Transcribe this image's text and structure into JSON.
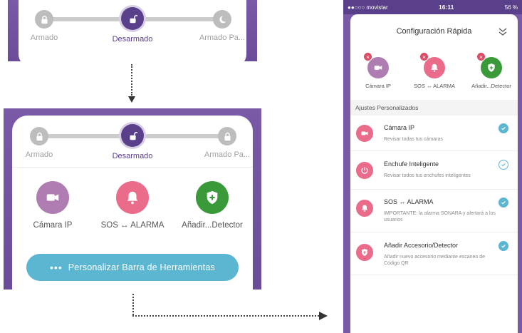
{
  "modes": {
    "armed": "Armado",
    "disarmed": "Desarmado",
    "home": "Armado Pa..."
  },
  "quick_actions": {
    "camera": "Cámara IP",
    "sos": "SOS ↔ ALARMA",
    "add": "Añadir...Detector"
  },
  "customize_button": {
    "dots": "•••",
    "label": "Personalizar Barra de Herramientas"
  },
  "phone": {
    "status_bar": {
      "carrier": "●●○○○ movistar",
      "time": "16:11",
      "battery": "56 %"
    },
    "title": "Configuración Rápida",
    "shortcuts": {
      "camera": "Cámara IP",
      "sos": "SOS ↔ ALARMA",
      "add": "Añadir...Detector"
    },
    "section_header": "Ajustes Personalizados",
    "items": [
      {
        "title": "Cámara IP",
        "subtitle": "Revisar todas tus cámaras",
        "checked": true
      },
      {
        "title": "Enchufe Inteligente",
        "subtitle": "Revisar todos tus enchufes inteligentes",
        "checked": false
      },
      {
        "title": "SOS ↔ ALARMA",
        "subtitle": "IMPORTANTE: la alarma SONARA y alertará a los usuarios",
        "checked": true
      },
      {
        "title": "Añadir Accesorio/Detector",
        "subtitle": "Añadir nuevo accesorio mediante escaneo de Código QR",
        "checked": true
      }
    ]
  },
  "colors": {
    "brand_purple": "#5a3f8a",
    "camera_purple": "#b07db2",
    "sos_pink": "#ea6b8a",
    "add_green": "#3a9a3a",
    "accent_blue": "#5bb6d2"
  }
}
